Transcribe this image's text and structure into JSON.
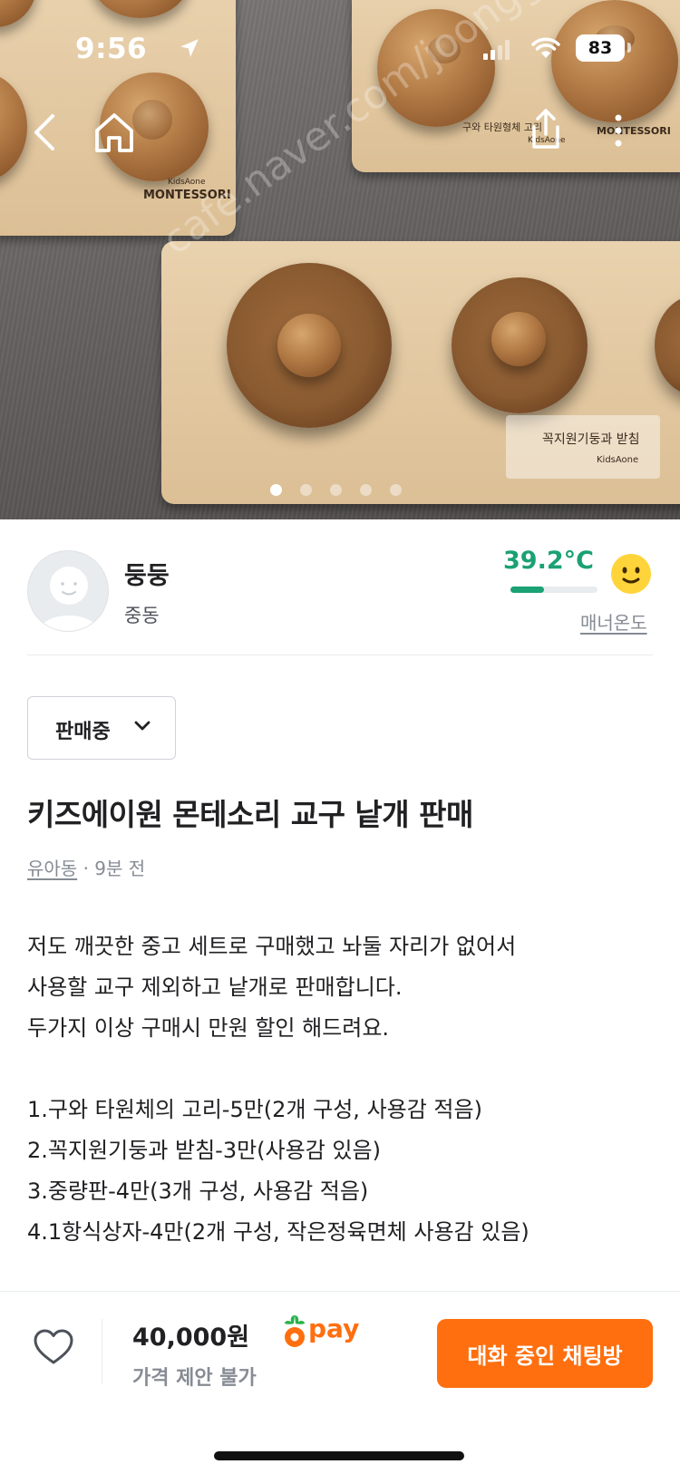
{
  "status_bar": {
    "time": "9:56",
    "battery": "83"
  },
  "hero": {
    "image_count": 5,
    "active_index": 0,
    "watermark": "cafe.naver.com/joonggonara",
    "photo_texts": {
      "brand_small": "KidsAone",
      "brand_big": "MONTESSORI",
      "label_top": "구와 타원형체 고리",
      "label_bottom": "꼭지원기둥과 받침",
      "brand_corner": "KidsAone"
    }
  },
  "seller": {
    "name": "둥둥",
    "location": "중동",
    "temperature": "39.2°C",
    "temperature_fill": 0.39,
    "temperature_color": "#1aa174",
    "manner_label": "매너온도"
  },
  "listing": {
    "status": "판매중",
    "title": "키즈에이원 몬테소리 교구 낱개 판매",
    "category": "유아동",
    "time_ago": "· 9분 전",
    "description_lines": [
      "저도 깨끗한 중고 세트로 구매했고 놔둘 자리가 없어서",
      "사용할 교구 제외하고 낱개로 판매합니다.",
      "두가지 이상 구매시 만원 할인 해드려요.",
      "",
      "1.구와 타원체의 고리-5만(2개 구성, 사용감 적음)",
      "2.꼭지원기둥과 받침-3만(사용감 있음)",
      "3.중량판-4만(3개 구성, 사용감 적음)",
      "4.1항식상자-4만(2개 구성, 작은정육면체 사용감 있음)"
    ]
  },
  "bottom_bar": {
    "price": "40,000원",
    "pay_label": "pay",
    "price_note": "가격 제안 불가",
    "chat_button": "대화 중인 채팅방",
    "accent_color": "#ff6f0f"
  },
  "icons": [
    "location-arrow-icon",
    "signal-icon",
    "wifi-icon",
    "back-icon",
    "home-icon",
    "share-icon",
    "more-icon",
    "chevron-down-icon",
    "smiley-face-icon",
    "heart-icon",
    "carrot-pay-icon"
  ]
}
